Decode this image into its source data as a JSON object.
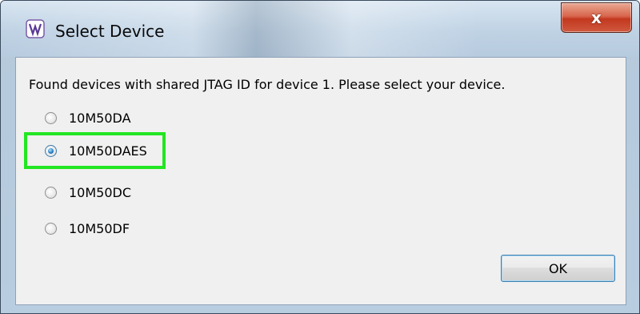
{
  "window": {
    "title": "Select Device",
    "close_label": "x"
  },
  "dialog": {
    "message": "Found devices with shared JTAG ID for device 1. Please select your device.",
    "options": [
      {
        "label": "10M50DA",
        "selected": false
      },
      {
        "label": "10M50DAES",
        "selected": true
      },
      {
        "label": "10M50DC",
        "selected": false
      },
      {
        "label": "10M50DF",
        "selected": false
      }
    ],
    "ok_label": "OK"
  },
  "colors": {
    "highlight": "#22e622",
    "close_button": "#c2381f",
    "radio_selected": "#2a7fc4"
  },
  "icons": {
    "app": "app-icon",
    "close": "close-icon"
  }
}
